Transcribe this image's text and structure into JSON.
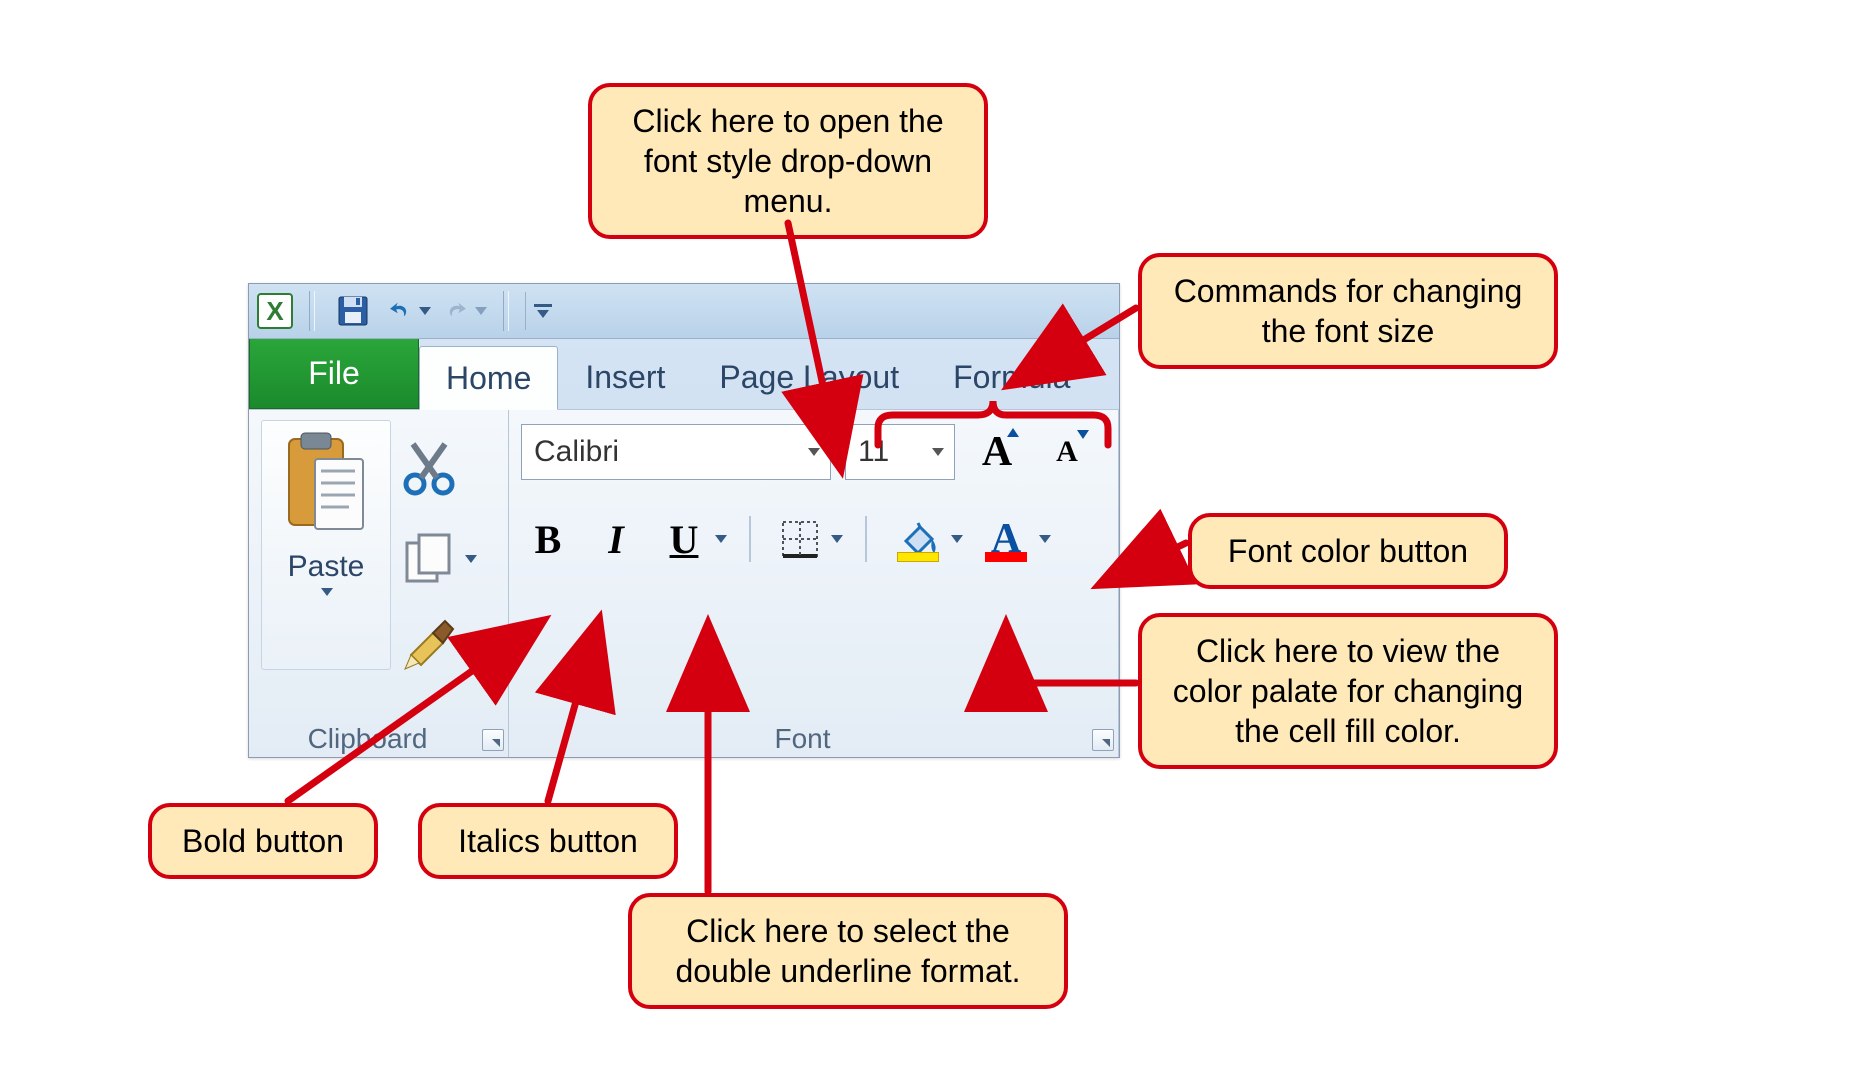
{
  "qat": {
    "app_letter": "X"
  },
  "tabs": {
    "file": "File",
    "home": "Home",
    "insert": "Insert",
    "pagelayout": "Page Layout",
    "formulas": "Formula"
  },
  "clipboard": {
    "paste_label": "Paste",
    "group_label": "Clipboard"
  },
  "font": {
    "name_value": "Calibri",
    "size_value": "11",
    "grow_letter": "A",
    "shrink_letter": "A",
    "bold_letter": "B",
    "italic_letter": "I",
    "underline_letter": "U",
    "fontcolor_letter": "A",
    "group_label": "Font"
  },
  "callouts": {
    "font_dropdown": "Click here to open the font style drop-down menu.",
    "font_size_cmds": "Commands for changing the font size",
    "font_color": "Font color button",
    "fill_color": "Click here to view the color palate for changing the cell fill color.",
    "bold": "Bold button",
    "italics": "Italics button",
    "double_underline": "Click here to select the double underline format."
  }
}
